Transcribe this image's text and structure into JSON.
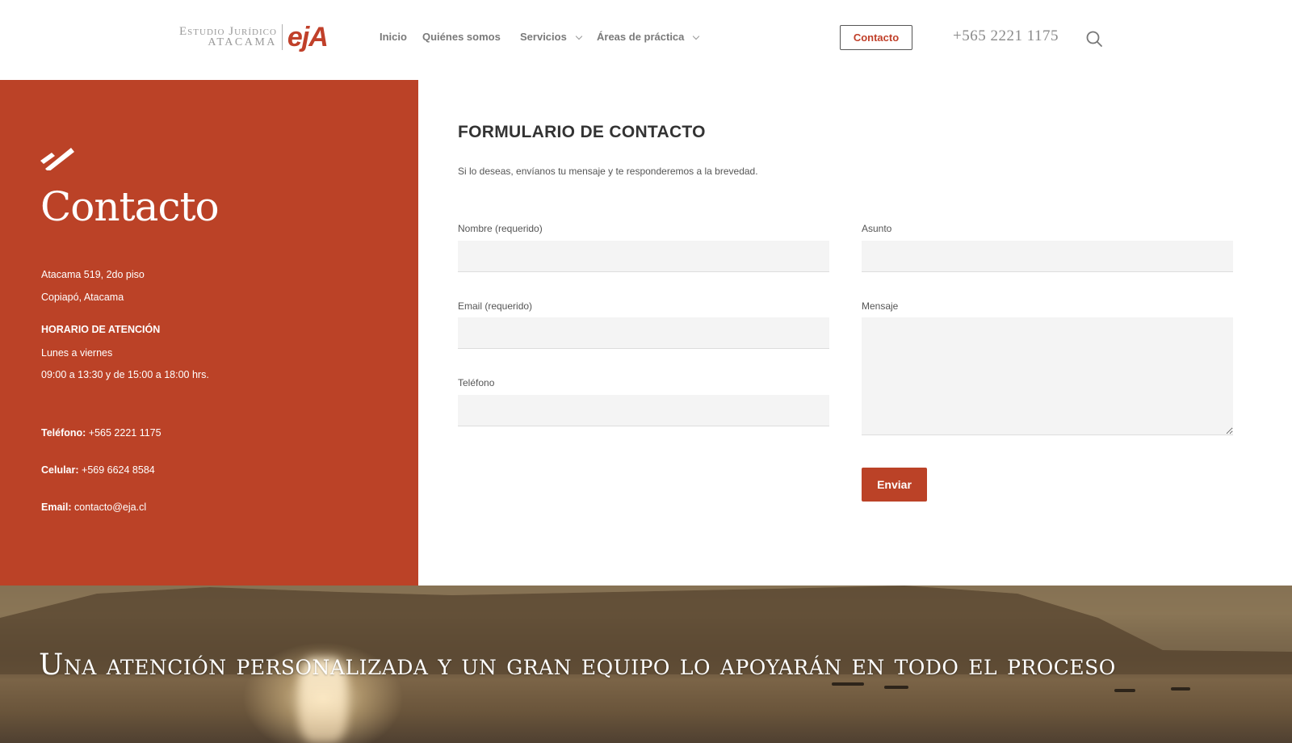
{
  "header": {
    "logo": {
      "line1": "Estudio Jurídico",
      "line2": "ATACAMA",
      "mark": "ejA"
    },
    "nav": [
      {
        "label": "Inicio",
        "has_dropdown": false
      },
      {
        "label": "Quiénes somos",
        "has_dropdown": false
      },
      {
        "label": "Servicios",
        "has_dropdown": true
      },
      {
        "label": "Áreas de práctica",
        "has_dropdown": true
      }
    ],
    "contact_button": "Contacto",
    "phone": "+565 2221 1175",
    "search_icon": "search-icon"
  },
  "sidebar": {
    "title": "Contacto",
    "address_line1": "Atacama 519, 2do piso",
    "address_line2": "Copiapó, Atacama",
    "hours_heading": "HORARIO DE ATENCIÓN",
    "hours_days": "Lunes a viernes",
    "hours_times": "09:00 a 13:30 y de 15:00 a 18:00 hrs.",
    "phone_label": "Teléfono:",
    "phone_value": " +565 2221 1175",
    "cell_label": "Celular:",
    "cell_value": " +569 6624 8584",
    "email_label": "Email:",
    "email_value": " contacto@eja.cl"
  },
  "form": {
    "title": "FORMULARIO DE CONTACTO",
    "subtitle": "Si lo deseas, envíanos tu mensaje y te responderemos a la brevedad.",
    "fields": {
      "nombre": {
        "label": "Nombre (requerido)",
        "value": ""
      },
      "email": {
        "label": "Email (requerido)",
        "value": ""
      },
      "telefono": {
        "label": "Teléfono",
        "value": ""
      },
      "asunto": {
        "label": "Asunto",
        "value": ""
      },
      "mensaje": {
        "label": "Mensaje",
        "value": ""
      }
    },
    "submit": "Enviar"
  },
  "banner": {
    "title": "Una atención personalizada y un gran equipo lo apoyarán en todo el proceso"
  },
  "colors": {
    "accent": "#bb4227",
    "logo_red": "#c0402a",
    "nav_text": "#7a7a7a",
    "field_bg": "#f4f4f4"
  }
}
